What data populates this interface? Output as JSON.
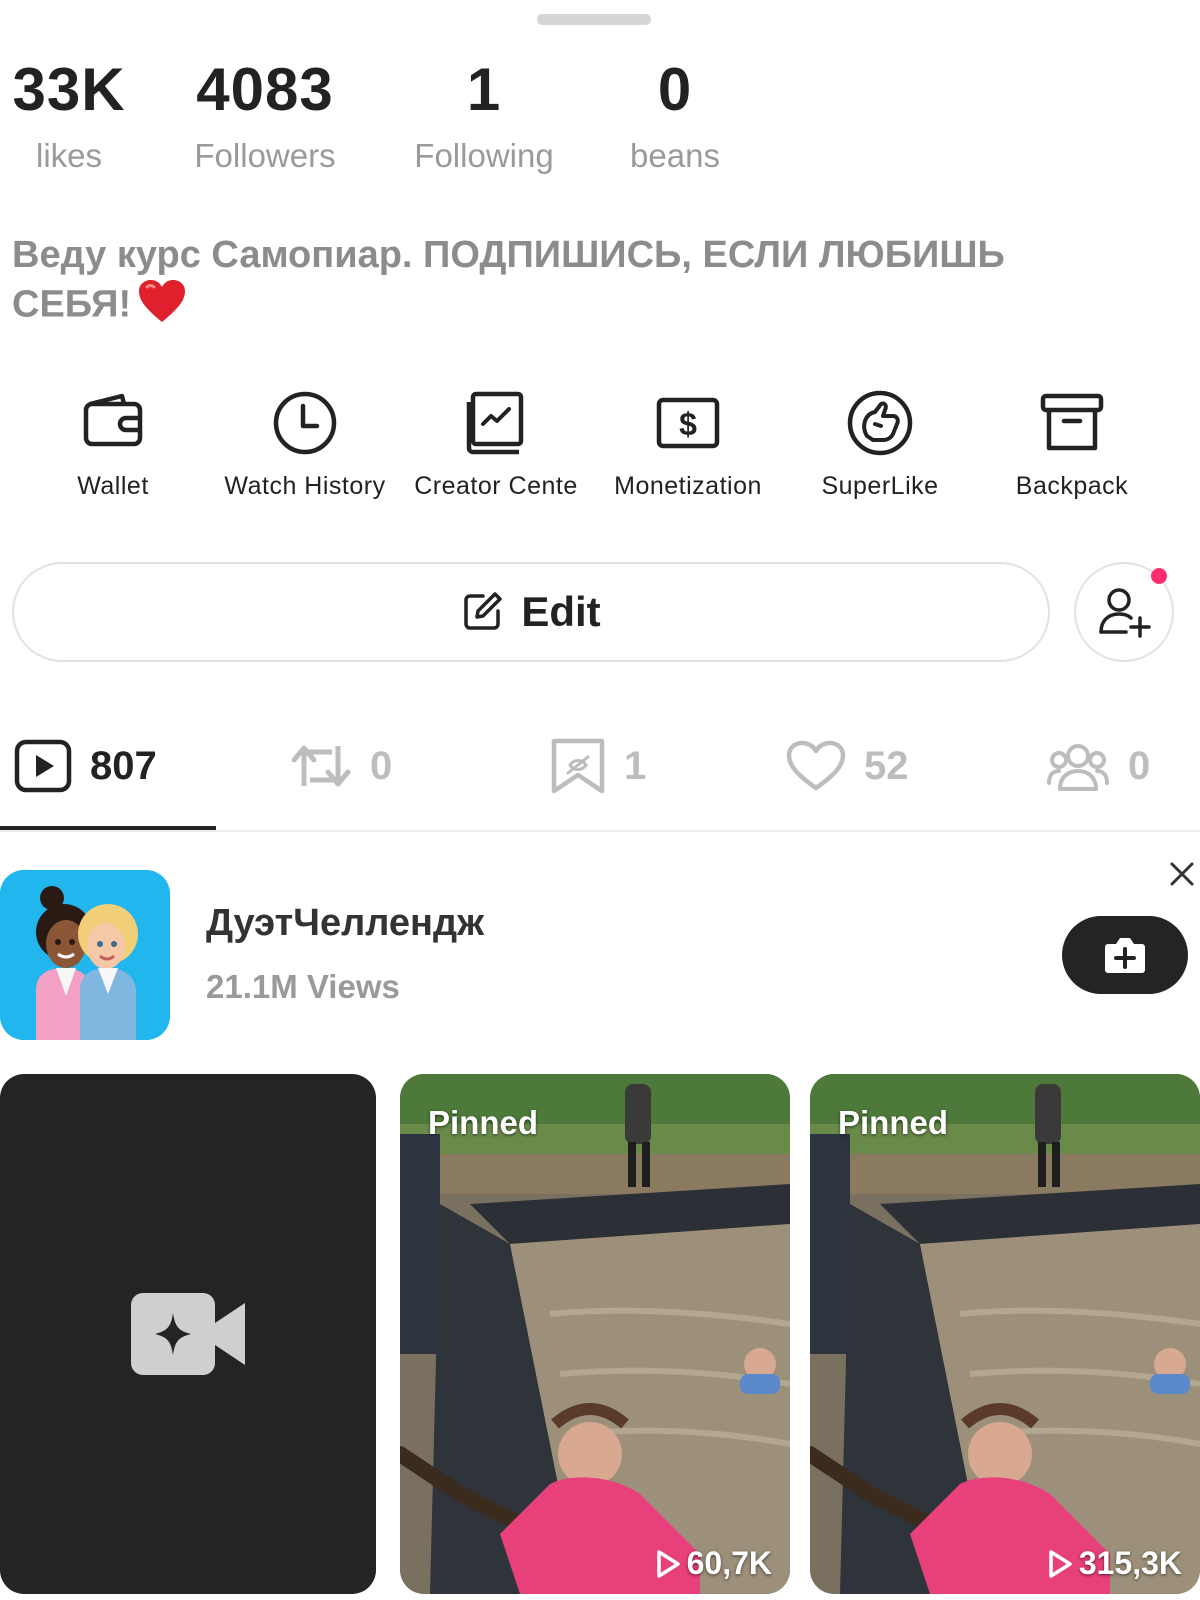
{
  "stats": [
    {
      "value": "33K",
      "label": "likes"
    },
    {
      "value": "4083",
      "label": "Followers"
    },
    {
      "value": "1",
      "label": "Following"
    },
    {
      "value": "0",
      "label": "beans"
    }
  ],
  "bio": "Веду курс Самопиар. ПОДПИШИСЬ, ЕСЛИ ЛЮБИШЬ СЕБЯ!",
  "tools": [
    {
      "label": "Wallet",
      "icon": "wallet-icon"
    },
    {
      "label": "Watch History",
      "icon": "clock-icon"
    },
    {
      "label": "Creator Cente",
      "icon": "chart-book-icon"
    },
    {
      "label": "Monetization",
      "icon": "dollar-icon"
    },
    {
      "label": "SuperLike",
      "icon": "superlike-icon"
    },
    {
      "label": "Backpack",
      "icon": "archive-box-icon"
    }
  ],
  "edit_label": "Edit",
  "tabs": [
    {
      "icon": "play-square-icon",
      "count": "807"
    },
    {
      "icon": "repost-icon",
      "count": "0"
    },
    {
      "icon": "bookmark-icon",
      "count": "1"
    },
    {
      "icon": "heart-outline-icon",
      "count": "52"
    },
    {
      "icon": "group-icon",
      "count": "0"
    }
  ],
  "challenge": {
    "title": "ДуэтЧеллендж",
    "views": "21.1M Views"
  },
  "videos": [
    {
      "pinned_label": "Pinned",
      "plays": "60,7K"
    },
    {
      "pinned_label": "Pinned",
      "plays": "315,3K"
    }
  ],
  "colors": {
    "accent_dot": "#ff2d6f",
    "dark": "#242424",
    "muted_text": "#9a9a9a"
  }
}
